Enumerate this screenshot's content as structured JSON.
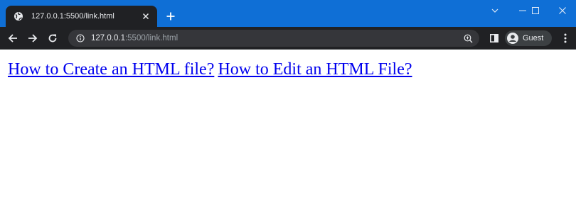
{
  "browser": {
    "tab": {
      "title": "127.0.0.1:5500/link.html",
      "favicon": "globe-icon"
    },
    "new_tab_label": "+",
    "window_controls": [
      "minimize-icon",
      "maximize-icon",
      "close-icon"
    ],
    "address_bar": {
      "url_host": "127.0.0.1",
      "url_path": ":5500/link.html"
    },
    "profile": {
      "label": "Guest"
    },
    "colors": {
      "title_bar": "#0f6fd6",
      "toolbar": "#202124",
      "omnibox": "#35363a"
    }
  },
  "page": {
    "links": [
      {
        "text": "How to Create an HTML file?"
      },
      {
        "text": "How to Edit an HTML File?"
      }
    ],
    "link_color": "#0000ee"
  }
}
